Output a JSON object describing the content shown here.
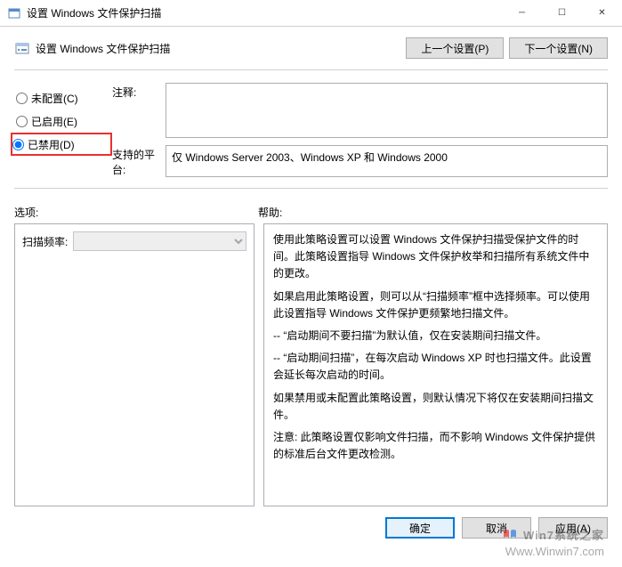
{
  "window": {
    "title": "设置 Windows 文件保护扫描"
  },
  "header": {
    "title": "设置 Windows 文件保护扫描",
    "prev_button": "上一个设置(P)",
    "next_button": "下一个设置(N)"
  },
  "radios": {
    "not_configured": "未配置(C)",
    "enabled": "已启用(E)",
    "disabled": "已禁用(D)",
    "selected": "disabled"
  },
  "fields": {
    "comment_label": "注释:",
    "comment_value": "",
    "platform_label": "支持的平台:",
    "platform_value": "仅 Windows Server 2003、Windows XP 和 Windows 2000"
  },
  "sections": {
    "options_label": "选项:",
    "help_label": "帮助:"
  },
  "options": {
    "scan_freq_label": "扫描频率:",
    "scan_freq_value": ""
  },
  "help": {
    "p1": "使用此策略设置可以设置 Windows 文件保护扫描受保护文件的时间。此策略设置指导 Windows 文件保护枚举和扫描所有系统文件中的更改。",
    "p2": "如果启用此策略设置，则可以从“扫描频率”框中选择频率。可以使用此设置指导 Windows 文件保护更频繁地扫描文件。",
    "p3": "-- “启动期间不要扫描”为默认值，仅在安装期间扫描文件。",
    "p4": "-- “启动期间扫描”，在每次启动 Windows XP 时也扫描文件。此设置会延长每次启动的时间。",
    "p5": "如果禁用或未配置此策略设置，则默认情况下将仅在安装期间扫描文件。",
    "p6": "注意: 此策略设置仅影响文件扫描，而不影响 Windows 文件保护提供的标准后台文件更改检测。"
  },
  "footer": {
    "ok": "确定",
    "cancel": "取消",
    "apply": "应用(A)"
  },
  "watermark": {
    "line1": "Win7系统之家",
    "line2": "Www.Winwin7.com"
  }
}
